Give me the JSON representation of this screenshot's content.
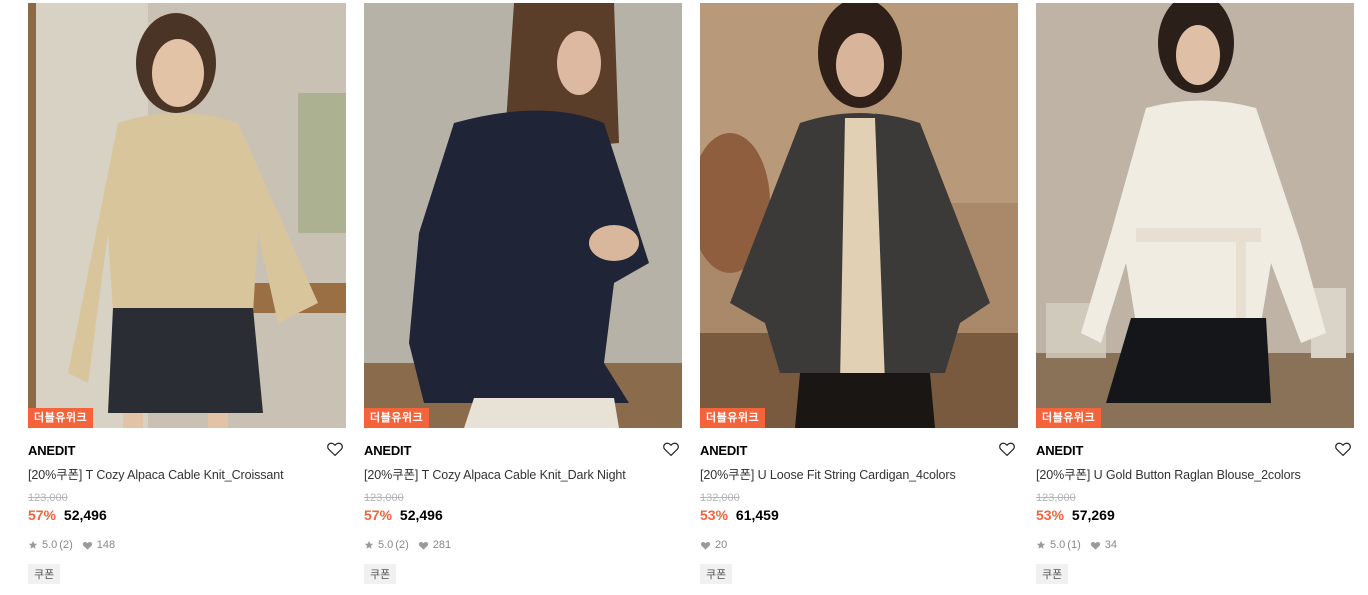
{
  "products": [
    {
      "badge": "더블유위크",
      "brand": "ANEDIT",
      "name": "[20%쿠폰] T Cozy Alpaca Cable Knit_Croissant",
      "original_price": "123,000",
      "discount": "57%",
      "price": "52,496",
      "rating": "5.0",
      "review_count": "(2)",
      "likes": "148",
      "coupon": "쿠폰",
      "colors": {
        "bg": "#c9c2b4",
        "garment": "#d8c59c",
        "skirt": "#2a2d33",
        "hair": "#4a3426"
      }
    },
    {
      "badge": "더블유위크",
      "brand": "ANEDIT",
      "name": "[20%쿠폰] T Cozy Alpaca Cable Knit_Dark Night",
      "original_price": "123,000",
      "discount": "57%",
      "price": "52,496",
      "rating": "5.0",
      "review_count": "(2)",
      "likes": "281",
      "coupon": "쿠폰",
      "colors": {
        "bg": "#b7b2a7",
        "garment": "#1f2537",
        "skirt": "#e8e2d6",
        "hair": "#5b3e2a"
      }
    },
    {
      "badge": "더블유위크",
      "brand": "ANEDIT",
      "name": "[20%쿠폰] U Loose Fit String Cardigan_4colors",
      "original_price": "132,000",
      "discount": "53%",
      "price": "61,459",
      "likes": "20",
      "coupon": "쿠폰",
      "colors": {
        "bg": "#a9896a",
        "garment": "#3b3a38",
        "skirt": "#1a1614",
        "hair": "#2e1f18"
      }
    },
    {
      "badge": "더블유위크",
      "brand": "ANEDIT",
      "name": "[20%쿠폰] U Gold Button Raglan Blouse_2colors",
      "original_price": "123,000",
      "discount": "53%",
      "price": "57,269",
      "rating": "5.0",
      "review_count": "(1)",
      "likes": "34",
      "coupon": "쿠폰",
      "colors": {
        "bg": "#bfb3a6",
        "garment": "#f1ece2",
        "skirt": "#15161a",
        "hair": "#2b1f1a"
      }
    }
  ],
  "icons": {
    "wishlist": "heart-outline-icon",
    "rating": "star-icon",
    "likes": "heart-filled-icon"
  }
}
